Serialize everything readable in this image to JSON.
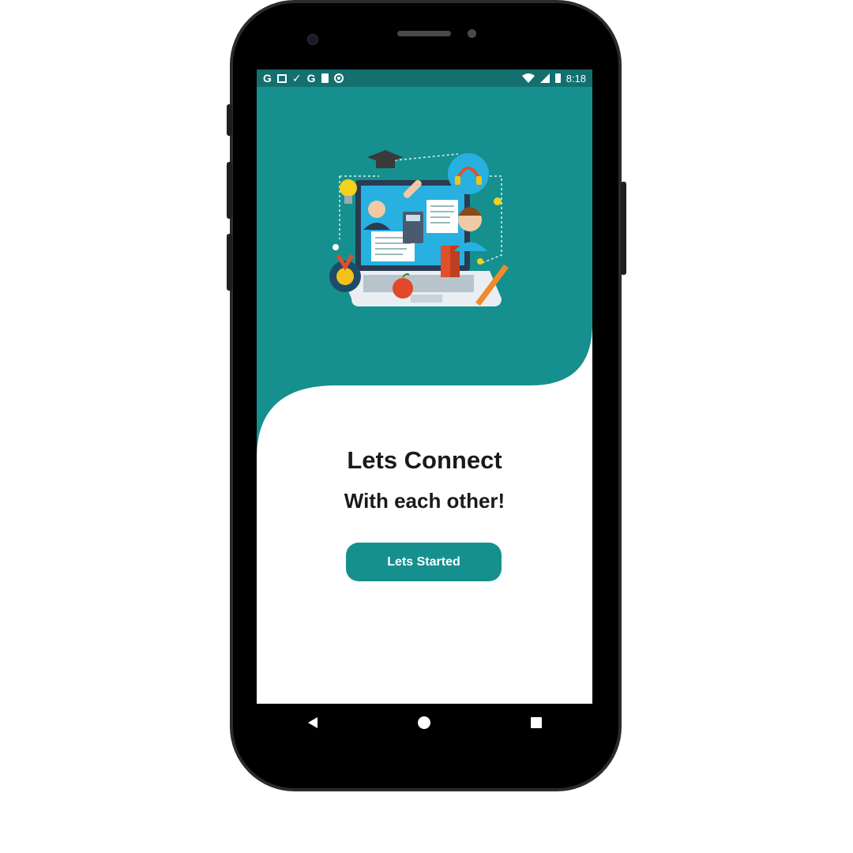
{
  "status_bar": {
    "left_icons": [
      "google-icon",
      "gallery-icon",
      "download-done-icon",
      "google-icon",
      "sd-card-icon",
      "radio-icon"
    ],
    "left_glyphs": [
      "G",
      "✓",
      "G"
    ],
    "time": "8:18",
    "right_icons": [
      "wifi-icon",
      "signal-icon",
      "battery-icon"
    ]
  },
  "colors": {
    "primary": "#15908f",
    "status_bar": "#14706f",
    "text": "#1a1a1a"
  },
  "main": {
    "illustration": "online-learning-illustration",
    "title": "Lets Connect",
    "subtitle": "With each other!",
    "cta_label": "Lets Started"
  },
  "nav_bar": {
    "buttons": [
      "back-icon",
      "home-icon",
      "recents-icon"
    ]
  }
}
